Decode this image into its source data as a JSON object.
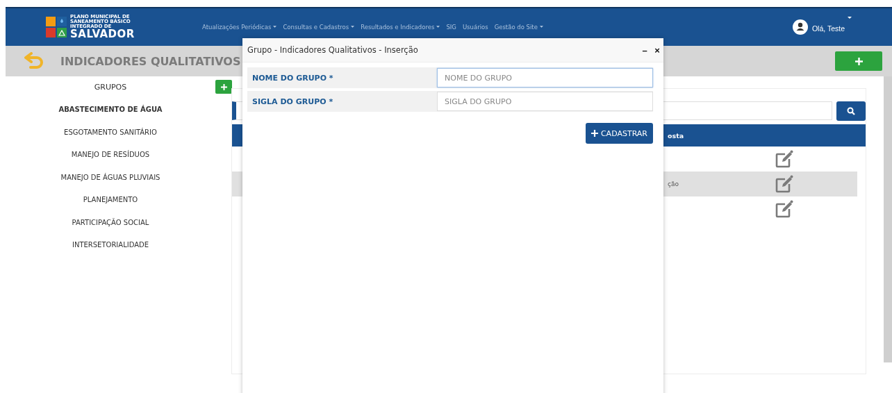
{
  "logo": {
    "lines": [
      "PLANO MUNICIPAL DE",
      "SANEAMENTO BÁSICO",
      "INTEGRADO DE"
    ],
    "name": "SALVADOR"
  },
  "nav": [
    {
      "label": "Atualizações Periódicas",
      "has_menu": true
    },
    {
      "label": "Consultas e Cadastros",
      "has_menu": true
    },
    {
      "label": "Resultados e Indicadores",
      "has_menu": true
    },
    {
      "label": "SIG",
      "has_menu": false
    },
    {
      "label": "Usuários",
      "has_menu": false
    },
    {
      "label": "Gestão do Site",
      "has_menu": true
    }
  ],
  "user": {
    "greeting": "Olá, Teste"
  },
  "page_title": "INDICADORES QUALITATIVOS",
  "sidebar": {
    "heading": "GRUPOS",
    "items": [
      {
        "label": "ABASTECIMENTO DE ÁGUA",
        "selected": true
      },
      {
        "label": "ESGOTAMENTO SANITÁRIO",
        "selected": false
      },
      {
        "label": "MANEJO DE RESÍDUOS",
        "selected": false
      },
      {
        "label": "MANEJO DE ÁGUAS PLUVIAIS",
        "selected": false
      },
      {
        "label": "PLANEJAMENTO",
        "selected": false
      },
      {
        "label": "PARTICIPAÇÃO SOCIAL",
        "selected": false
      },
      {
        "label": "INTERSETORIALIDADE",
        "selected": false
      }
    ]
  },
  "table": {
    "column_text": "osta",
    "rows": [
      {
        "highlighted": false
      },
      {
        "text": "ção",
        "highlighted": true
      },
      {
        "highlighted": false
      }
    ]
  },
  "dialog": {
    "title": "Grupo - Indicadores Qualitativos - Inserção",
    "minimize": "–",
    "close": "×",
    "fields": [
      {
        "label": "NOME DO GRUPO *",
        "placeholder": "NOME DO GRUPO",
        "focused": true
      },
      {
        "label": "SIGLA DO GRUPO *",
        "placeholder": "SIGLA DO GRUPO",
        "focused": false
      }
    ],
    "submit": "CADASTRAR"
  }
}
